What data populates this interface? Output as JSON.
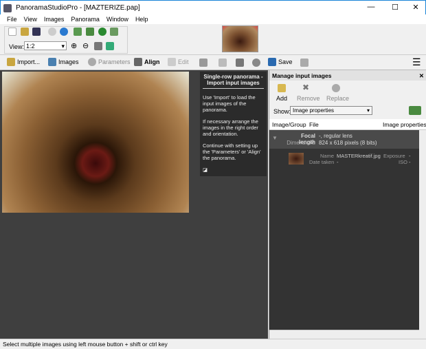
{
  "window": {
    "title": "PanoramaStudioPro - [MAZTERIZE.pap]",
    "minimize": "—",
    "maximize": "☐",
    "close": "✕"
  },
  "menu": [
    "File",
    "View",
    "Images",
    "Panorama",
    "Window",
    "Help"
  ],
  "view": {
    "label": "View:",
    "value": "1:2"
  },
  "toolbar": {
    "import": "Import...",
    "images": "Images",
    "parameters": "Parameters",
    "align": "Align",
    "edit": "Edit",
    "save": "Save"
  },
  "info": {
    "title": "Single-row panorama - Import input images",
    "p1": "Use 'Import' to load the input images of the panorama.",
    "p2": "If necessary arrange the images in the right order and orientation.",
    "p3": "Continue with setting up the 'Parameters' or 'Align' the panorama."
  },
  "panel": {
    "title": "Manage input images",
    "add": "Add",
    "remove": "Remove",
    "replace": "Replace",
    "show_label": "Show:",
    "show_value": "Image properties",
    "columns": [
      "Image/Group",
      "File",
      "Image properties"
    ],
    "group": {
      "focal_label": "Focal length",
      "focal_value": "-, regular lens",
      "dim_label": "Dimensions",
      "dim_value": "824 x 618 pixels (8 bits)"
    },
    "item": {
      "name_label": "Name",
      "name_value": "MASTERkreatif.jpg",
      "date_label": "Date taken",
      "date_value": "-",
      "exposure_label": "Exposure",
      "exposure_value": "-",
      "iso_label": "ISO",
      "iso_value": "-"
    }
  },
  "status": "Select multiple images using left mouse button + shift or ctrl key"
}
